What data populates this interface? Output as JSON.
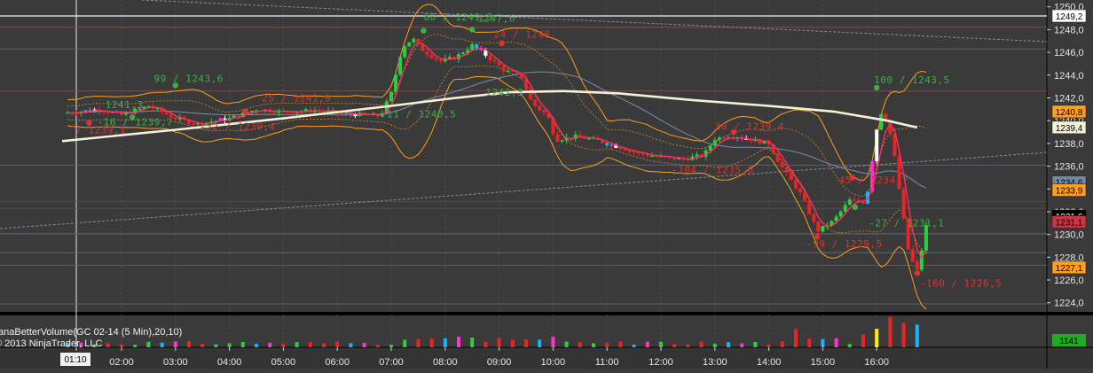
{
  "chart_data": {
    "type": "candlestick",
    "instrument": "GC 02-14 (5 Min)",
    "price_axis": {
      "range": [
        1223.2,
        1250.6
      ],
      "ticks": [
        "1250,0",
        "1248,0",
        "1246,0",
        "1244,0",
        "1242,0",
        "1240,0",
        "1238,0",
        "1236,0",
        "1234,0",
        "1232,0",
        "1230,0",
        "1228,0",
        "1226,0",
        "1224,0"
      ]
    },
    "time_axis": {
      "ticks": [
        "01:10",
        "02:00",
        "03:00",
        "04:00",
        "05:00",
        "06:00",
        "07:00",
        "08:00",
        "09:00",
        "10:00",
        "11:00",
        "12:00",
        "13:00",
        "14:00",
        "15:00",
        "16:00"
      ],
      "cursor_label": "01:10"
    },
    "price_tags": [
      {
        "label": "1249,2",
        "price": 1249.2,
        "bg": "#ffffff",
        "fg": "#000000"
      },
      {
        "label": "1240,8",
        "price": 1240.8,
        "bg": "#ff9f1a",
        "fg": "#000000"
      },
      {
        "label": "1239,4",
        "price": 1239.4,
        "bg": "#f5f0d6",
        "fg": "#000000"
      },
      {
        "label": "1234,6",
        "price": 1234.6,
        "bg": "#6f8aa5",
        "fg": "#000000"
      },
      {
        "label": "1233,9",
        "price": 1233.9,
        "bg": "#ff9f1a",
        "fg": "#000000"
      },
      {
        "label": "1231,6",
        "price": 1231.6,
        "bg": "#000000",
        "fg": "#ffffff"
      },
      {
        "label": "1231,1",
        "price": 1231.1,
        "bg": "#cc3344",
        "fg": "#000000"
      },
      {
        "label": "1227,1",
        "price": 1227.1,
        "bg": "#ff9f1a",
        "fg": "#000000"
      }
    ],
    "annotations": [
      {
        "text": "1241,3",
        "tx": 0.7,
        "price": 1241.1,
        "color": "#3cb043"
      },
      {
        "text": "99 / 1243,6",
        "tx": 1.6,
        "price": 1243.4,
        "color": "#3cb043"
      },
      {
        "text": "25 / 1241,9",
        "tx": 3.6,
        "price": 1241.7,
        "color": "#e03030"
      },
      {
        "text": "-16 / 1239,7",
        "tx": 0.55,
        "price": 1239.6,
        "color": "#3cb043"
      },
      {
        "text": "/ 1239,1",
        "tx": 0.15,
        "price": 1238.9,
        "color": "#e03030"
      },
      {
        "text": "-52 / 1239,4",
        "tx": 2.45,
        "price": 1239.2,
        "color": "#e03030"
      },
      {
        "text": "-11 / 1240,5",
        "tx": 5.8,
        "price": 1240.3,
        "color": "#3cb043"
      },
      {
        "text": "60 / 1249,3",
        "tx": 6.6,
        "price": 1248.8,
        "color": "#3cb043"
      },
      {
        "text": "1247,6",
        "tx": 7.6,
        "price": 1248.7,
        "color": "#3cb043"
      },
      {
        "text": "24 / 1248",
        "tx": 7.9,
        "price": 1247.3,
        "color": "#e03030"
      },
      {
        "text": "1242,3",
        "tx": 7.75,
        "price": 1242.2,
        "color": "#3cb043"
      },
      {
        "text": "38 / 1239,4",
        "tx": 12.0,
        "price": 1239.2,
        "color": "#e03030"
      },
      {
        "text": "-104 / 1235,6",
        "tx": 11.2,
        "price": 1235.4,
        "color": "#e03030"
      },
      {
        "text": "100 / 1243,5",
        "tx": 14.95,
        "price": 1243.3,
        "color": "#3cb043"
      },
      {
        "text": "45 / 1234,7",
        "tx": 14.3,
        "price": 1234.5,
        "color": "#e03030"
      },
      {
        "text": "-27 / 1231,1",
        "tx": 14.85,
        "price": 1230.7,
        "color": "#3cb043"
      },
      {
        "text": "-99 / 1229,5",
        "tx": 13.7,
        "price": 1228.9,
        "color": "#e03030"
      },
      {
        "text": "-160 / 1226,5",
        "tx": 15.8,
        "price": 1225.4,
        "color": "#e03030"
      }
    ],
    "indicator": {
      "title": "anaBetterVolume(GC 02-14 (5 Min),20,10)",
      "copyright": "© 2013 NinjaTrader, LLC",
      "value_tag": "1141",
      "value_tag_bg": "#22aa22"
    },
    "colors": {
      "background": "#3a3a3a",
      "panel_separator": "#000000",
      "up": "#2ecc40",
      "down": "#ee2222",
      "climax_up": "#17b3ff",
      "climax_down": "#ff33cc",
      "churn": "#ffee00",
      "ema_long": "#f5f0d6",
      "bands": "#ff9f1a"
    },
    "key_prices": {
      "open": 1240.7,
      "high_of_session": 1249.3,
      "low_of_session": 1226.5,
      "last": 1231.6
    },
    "support_resistance": [
      1249.2,
      1248.2,
      1246.3,
      1242.6,
      1236.1,
      1230.1,
      1228.4,
      1227.3,
      1223.9
    ]
  }
}
